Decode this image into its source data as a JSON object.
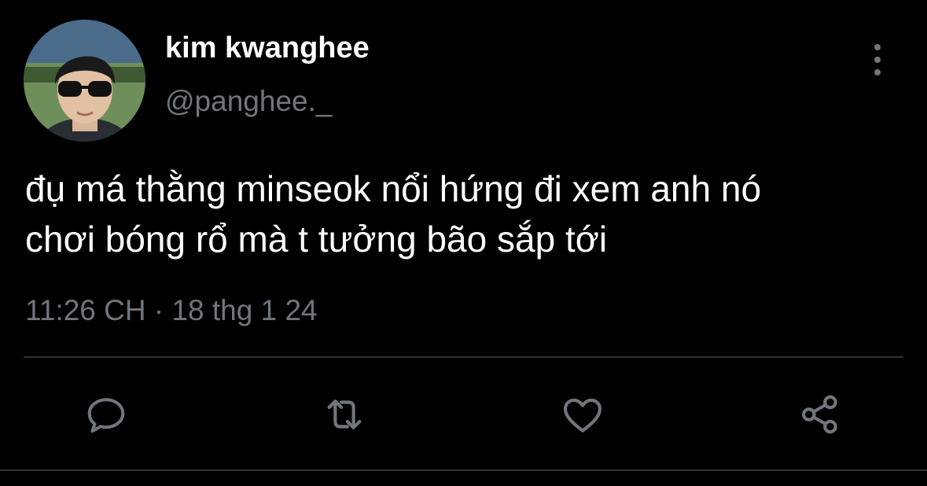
{
  "author": {
    "display_name": "kim kwanghee",
    "handle": "@panghee._"
  },
  "tweet": {
    "text_lines": [
      "đụ má thằng minseok nổi hứng đi xem anh nó",
      "chơi bóng rổ mà t tưởng bão sắp tới"
    ],
    "time": "11:26 CH",
    "separator": "·",
    "date": "18 thg 1 24"
  },
  "actions": [
    {
      "icon": "reply-icon"
    },
    {
      "icon": "retweet-icon"
    },
    {
      "icon": "like-icon"
    },
    {
      "icon": "share-icon"
    }
  ],
  "colors": {
    "background": "#000000",
    "primary_text": "#ffffff",
    "secondary_text": "#71767b",
    "divider": "#2f3336"
  }
}
